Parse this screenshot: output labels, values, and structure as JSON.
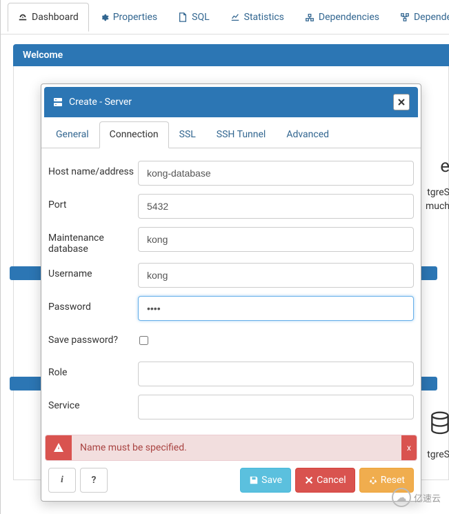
{
  "topTabs": {
    "dashboard": "Dashboard",
    "properties": "Properties",
    "sql": "SQL",
    "statistics": "Statistics",
    "dependencies": "Dependencies",
    "dependents": "Dependents"
  },
  "welcome": {
    "title": "Welcome",
    "bg_line1_e": "e",
    "bg_line2": "tgreS",
    "bg_line3": "much",
    "bg_line4": "tgreS"
  },
  "modal": {
    "title": "Create - Server",
    "tabs": {
      "general": "General",
      "connection": "Connection",
      "ssl": "SSL",
      "sshtunnel": "SSH Tunnel",
      "advanced": "Advanced"
    },
    "form": {
      "host_label": "Host name/address",
      "host_value": "kong-database",
      "port_label": "Port",
      "port_value": "5432",
      "maintdb_label": "Maintenance database",
      "maintdb_value": "kong",
      "username_label": "Username",
      "username_value": "kong",
      "password_label": "Password",
      "password_value": "kong",
      "savepw_label": "Save password?",
      "role_label": "Role",
      "role_value": "",
      "service_label": "Service",
      "service_value": ""
    },
    "error": {
      "text": "Name must be specified.",
      "close": "x"
    },
    "buttons": {
      "info": "i",
      "help": "?",
      "save": "Save",
      "cancel": "Cancel",
      "reset": "Reset"
    }
  },
  "watermark": "亿速云"
}
